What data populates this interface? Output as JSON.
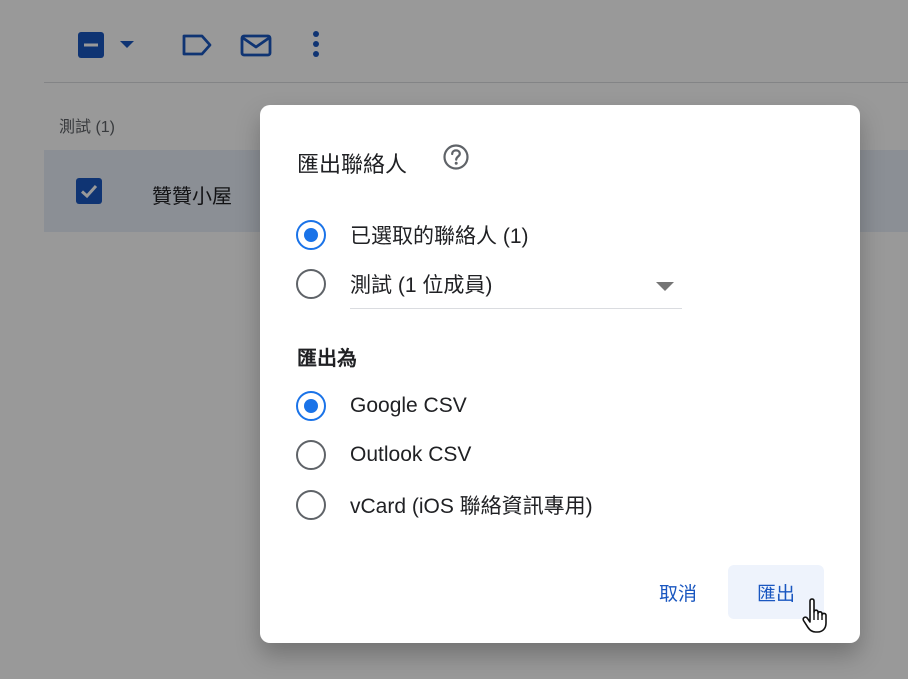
{
  "toolbar": {
    "select_checkbox_icon": "minus-checkbox-icon",
    "select_dropdown_icon": "caret-down-icon",
    "label_icon": "label-icon",
    "email_icon": "mail-icon",
    "more_icon": "more-vert-icon"
  },
  "list": {
    "group_label": "測試 (1)",
    "contacts": [
      {
        "name": "贊贊小屋",
        "checked": true
      }
    ]
  },
  "dialog": {
    "title": "匯出聯絡人",
    "help_icon": "help-circle-icon",
    "scope_options": [
      {
        "label": "已選取的聯絡人 (1)",
        "checked": true
      },
      {
        "label": "測試 (1 位成員)",
        "checked": false
      }
    ],
    "export_as_title": "匯出為",
    "format_options": [
      {
        "label": "Google CSV",
        "checked": true
      },
      {
        "label": "Outlook CSV",
        "checked": false
      },
      {
        "label": "vCard (iOS 聯絡資訊專用)",
        "checked": false
      }
    ],
    "cancel_label": "取消",
    "export_label": "匯出"
  },
  "colors": {
    "accent": "#1a73e8",
    "primary_dark": "#1a57c0",
    "scrim": "rgba(0,0,0,0.40)"
  }
}
